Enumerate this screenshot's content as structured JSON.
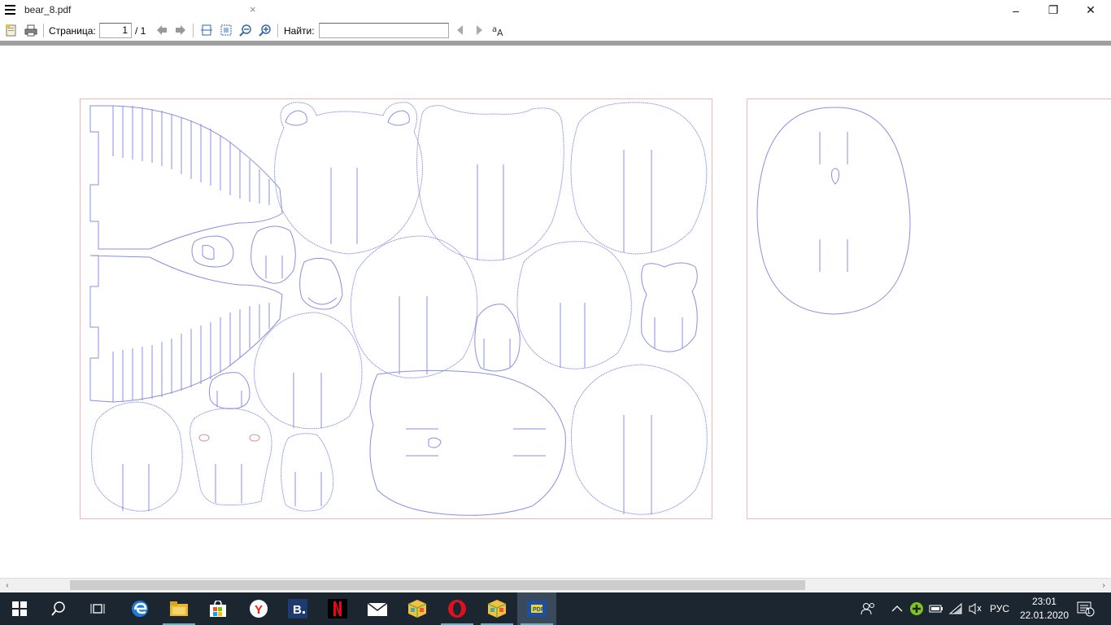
{
  "window": {
    "tab_title": "bear_8.pdf",
    "tab_close": "×",
    "minimize": "–",
    "maximize": "❐",
    "close": "✕"
  },
  "toolbar": {
    "page_label": "Страница:",
    "page_value": "1",
    "page_total": "/ 1",
    "find_label": "Найти:",
    "find_value": ""
  },
  "scrollbar": {
    "left_arrow": "‹",
    "right_arrow": "›"
  },
  "taskbar": {
    "apps": [
      "start-icon",
      "search-icon",
      "task-view-icon",
      "edge-icon",
      "file-explorer-icon",
      "store-icon",
      "yandex-icon",
      "b-app-icon",
      "netflix-icon",
      "mail-icon",
      "cube-app-icon",
      "opera-icon",
      "cube-app-icon",
      "pdf-reader-icon"
    ],
    "language": "РУС",
    "time": "23:01",
    "date": "22.01.2020",
    "notification_count": "1"
  }
}
